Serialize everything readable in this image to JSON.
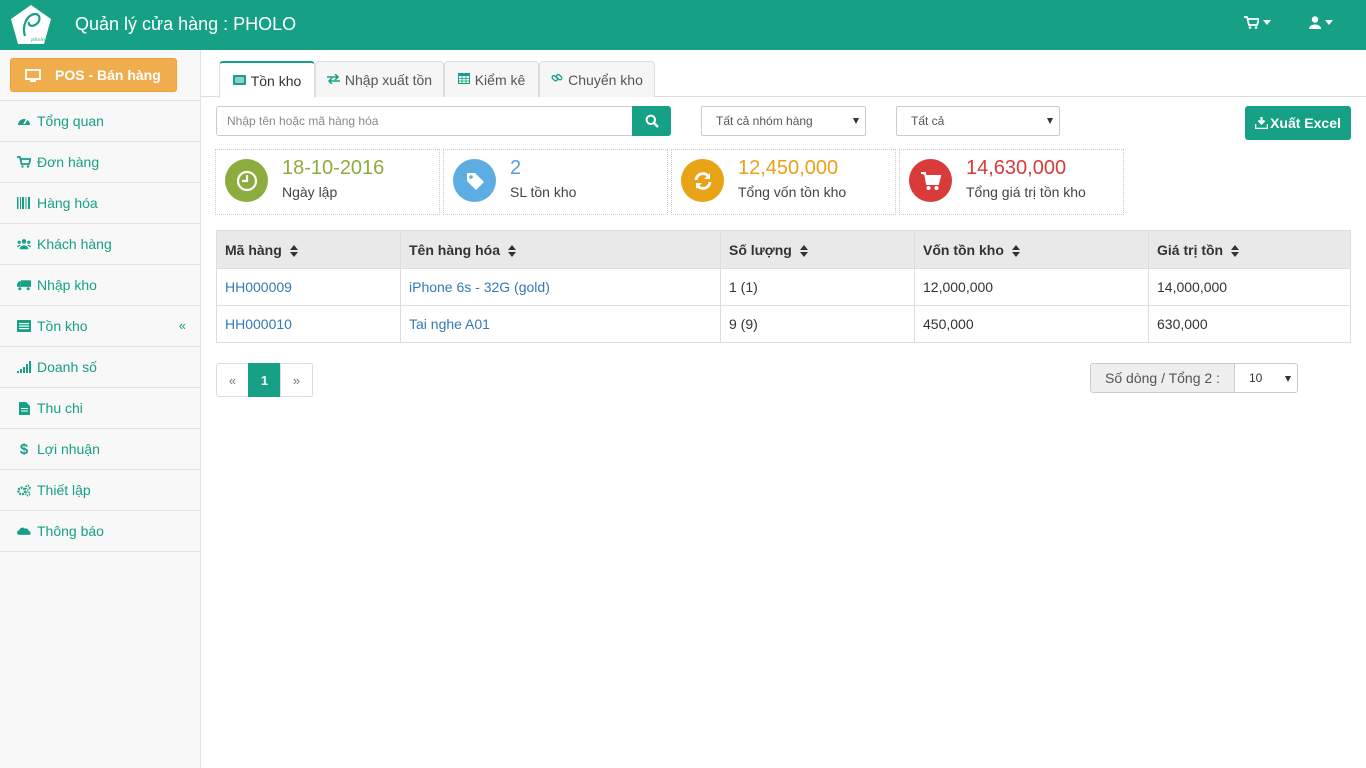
{
  "header": {
    "title": "Quản lý cửa hàng : PHOLO",
    "logo_text": "pholo",
    "accent": "#16a085"
  },
  "sidebar": {
    "pos_label": "POS - Bán hàng",
    "items": [
      {
        "label": "Tổng quan",
        "icon": "dashboard-icon"
      },
      {
        "label": "Đơn hàng",
        "icon": "cart-icon"
      },
      {
        "label": "Hàng hóa",
        "icon": "barcode-icon"
      },
      {
        "label": "Khách hàng",
        "icon": "users-icon"
      },
      {
        "label": "Nhập kho",
        "icon": "truck-icon"
      },
      {
        "label": "Tồn kho",
        "icon": "list-icon"
      },
      {
        "label": "Doanh số",
        "icon": "signal-icon"
      },
      {
        "label": "Thu chi",
        "icon": "file-icon"
      },
      {
        "label": "Lợi nhuận",
        "icon": "dollar-icon"
      },
      {
        "label": "Thiết lập",
        "icon": "gears-icon"
      },
      {
        "label": "Thông báo",
        "icon": "cloud-icon"
      }
    ]
  },
  "tabs": [
    {
      "label": "Tồn kho",
      "icon": "list-icon"
    },
    {
      "label": "Nhập xuất tồn",
      "icon": "exchange-icon"
    },
    {
      "label": "Kiểm kê",
      "icon": "calendar-icon"
    },
    {
      "label": "Chuyển kho",
      "icon": "link-icon"
    }
  ],
  "filters": {
    "search_placeholder": "Nhập tên hoặc mã hàng hóa",
    "group_select": "Tất cả nhóm hàng",
    "status_select": "Tất cả",
    "export_label": "Xuất Excel"
  },
  "stats": [
    {
      "value": "18-10-2016",
      "label": "Ngày lập",
      "color": "#8cad3d",
      "circle": "#8cad3d",
      "icon": "clock-icon"
    },
    {
      "value": "2",
      "label": "SL tồn kho",
      "color": "#5b9bd5",
      "circle": "#5dade2",
      "icon": "tag-icon"
    },
    {
      "value": "12,450,000",
      "label": "Tổng vốn tồn kho",
      "color": "#e8a317",
      "circle": "#e8a317",
      "icon": "refresh-icon"
    },
    {
      "value": "14,630,000",
      "label": "Tổng giá trị tồn kho",
      "color": "#d93a3a",
      "circle": "#d93a3a",
      "icon": "cart-icon"
    }
  ],
  "table": {
    "columns": [
      "Mã hàng",
      "Tên hàng hóa",
      "Số lượng",
      "Vốn tồn kho",
      "Giá trị tồn"
    ],
    "rows": [
      [
        "HH000009",
        "iPhone 6s - 32G (gold)",
        "1 (1)",
        "12,000,000",
        "14,000,000"
      ],
      [
        "HH000010",
        "Tai nghe A01",
        "9 (9)",
        "450,000",
        "630,000"
      ]
    ]
  },
  "pagination": {
    "prev": "«",
    "current": "1",
    "next": "»",
    "rows_label": "Số dòng / Tổng 2 :",
    "rows_value": "10"
  }
}
